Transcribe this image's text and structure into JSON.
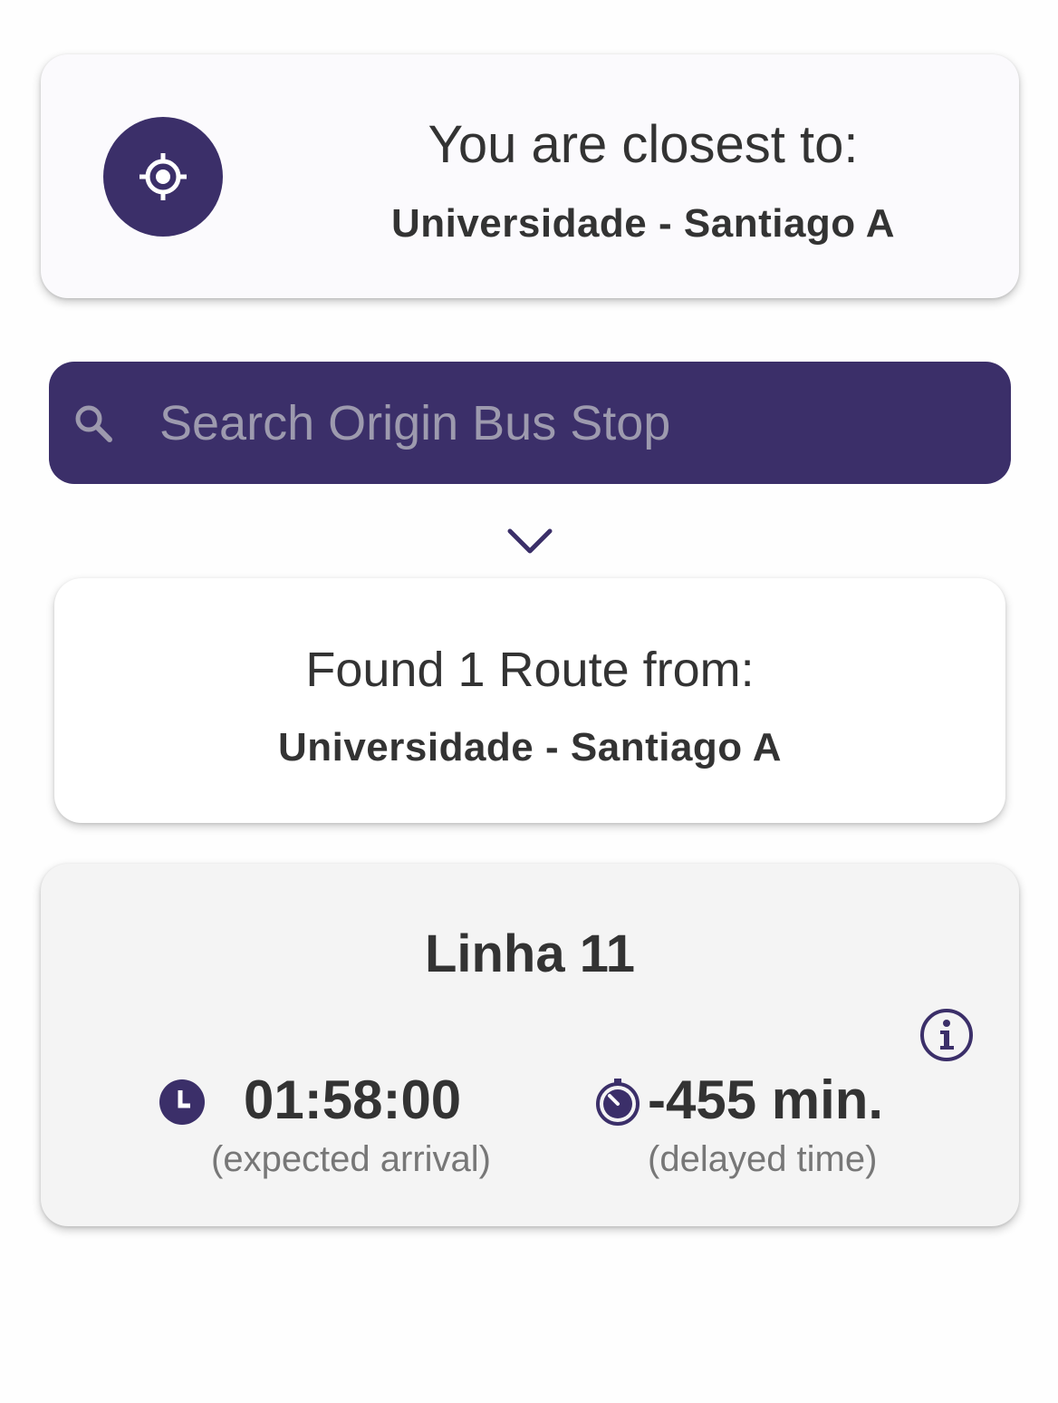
{
  "colors": {
    "accent": "#3b2f69",
    "text": "#333333",
    "muted": "#777777",
    "placeholder": "#9d9aae"
  },
  "closest": {
    "icon": "gps-locate-icon",
    "title": "You are closest to:",
    "stop": "Universidade - Santiago A"
  },
  "search": {
    "icon": "search-icon",
    "placeholder": "Search Origin Bus Stop",
    "value": ""
  },
  "expand": {
    "icon": "chevron-down-icon"
  },
  "found": {
    "title": "Found 1 Route from:",
    "stop": "Universidade - Santiago A"
  },
  "route": {
    "name": "Linha 11",
    "info_icon": "info-icon",
    "arrival": {
      "icon": "clock-icon",
      "value": "01:58:00",
      "label": "(expected arrival)"
    },
    "delay": {
      "icon": "timer-icon",
      "value": "-455 min.",
      "label": "(delayed time)"
    }
  }
}
